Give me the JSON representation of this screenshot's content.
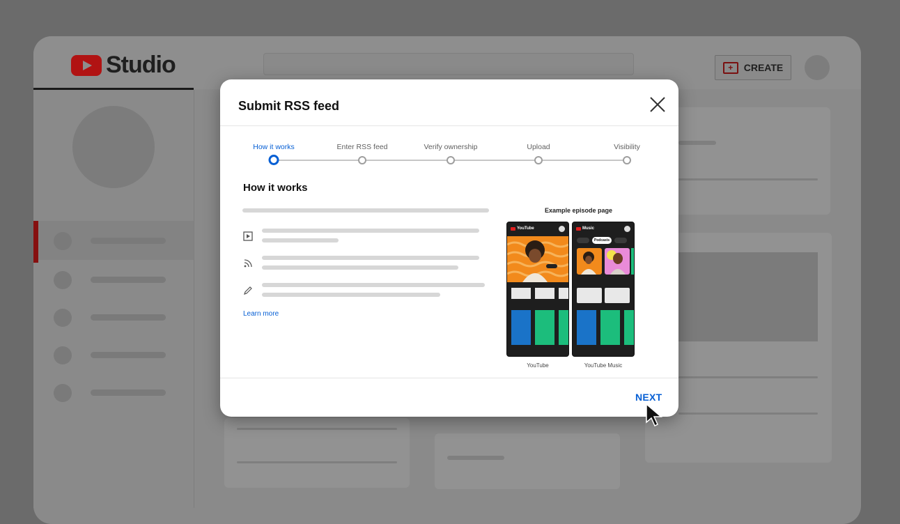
{
  "app": {
    "name": "Studio"
  },
  "header": {
    "create_label": "CREATE"
  },
  "dialog": {
    "title": "Submit RSS feed",
    "steps": [
      "How it works",
      "Enter RSS feed",
      "Verify ownership",
      "Upload",
      "Visibility"
    ],
    "active_step": 0,
    "section_title": "How it works",
    "learn_more": "Learn more",
    "example": {
      "title": "Example episode page",
      "apps": [
        {
          "caption": "YouTube",
          "brand": "YouTube"
        },
        {
          "caption": "YouTube Music",
          "brand": "Music",
          "chip": "Podcasts"
        }
      ]
    },
    "next_label": "NEXT"
  },
  "icons": [
    "youtube-logo-icon",
    "create-video-icon",
    "close-icon",
    "play-square-icon",
    "rss-icon",
    "pencil-icon",
    "mouse-cursor-icon"
  ],
  "colors": {
    "accent": "#065fd4",
    "brand_red": "#ff0000"
  }
}
